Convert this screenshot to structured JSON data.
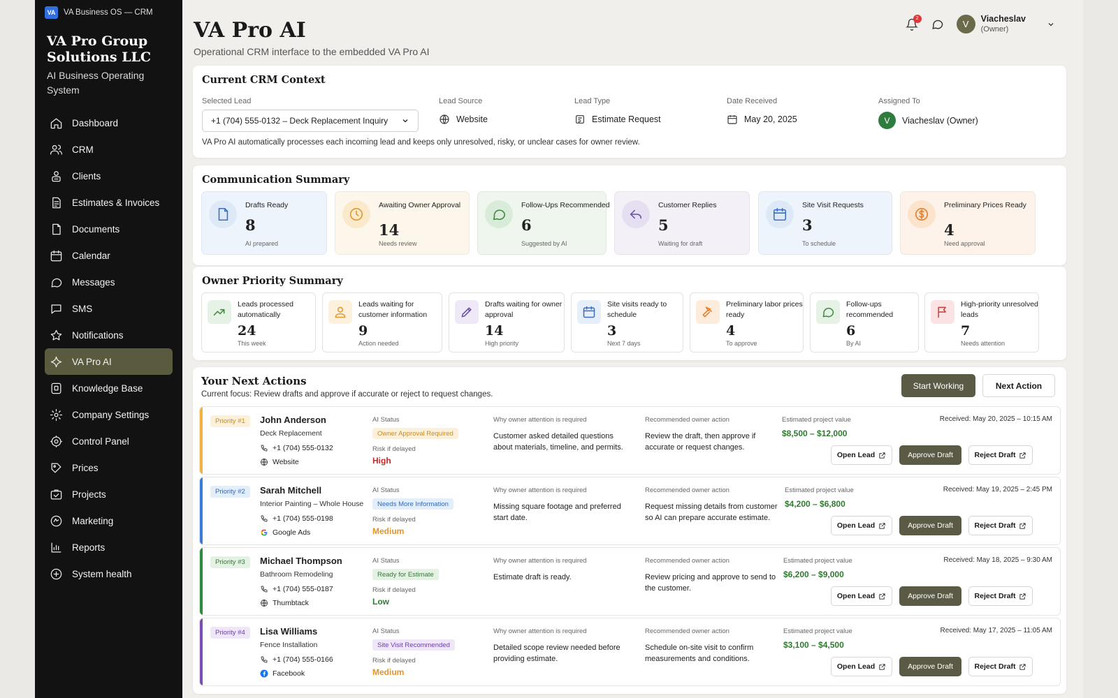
{
  "sidebar": {
    "app_title": "VA Business OS — CRM",
    "badge": "VA",
    "company": "VA Pro Group Solutions LLC",
    "tagline": "AI Business Operating System",
    "items": [
      {
        "label": "Dashboard",
        "icon": "home-icon"
      },
      {
        "label": "CRM",
        "icon": "users-icon"
      },
      {
        "label": "Clients",
        "icon": "clients-icon"
      },
      {
        "label": "Estimates & Invoices",
        "icon": "file-text-icon"
      },
      {
        "label": "Documents",
        "icon": "document-icon"
      },
      {
        "label": "Calendar",
        "icon": "calendar-icon"
      },
      {
        "label": "Messages",
        "icon": "message-icon"
      },
      {
        "label": "SMS",
        "icon": "sms-icon"
      },
      {
        "label": "Notifications",
        "icon": "bell-icon"
      },
      {
        "label": "VA Pro AI",
        "icon": "sparkle-icon",
        "active": true
      },
      {
        "label": "Knowledge Base",
        "icon": "book-icon"
      },
      {
        "label": "Company Settings",
        "icon": "gear-icon"
      },
      {
        "label": "Control Panel",
        "icon": "control-icon"
      },
      {
        "label": "Prices",
        "icon": "price-icon"
      },
      {
        "label": "Projects",
        "icon": "projects-icon"
      },
      {
        "label": "Marketing",
        "icon": "marketing-icon"
      },
      {
        "label": "Reports",
        "icon": "reports-icon"
      },
      {
        "label": "System health",
        "icon": "health-icon"
      }
    ]
  },
  "header": {
    "title": "VA Pro AI",
    "subtitle": "Operational CRM interface to the embedded VA Pro AI",
    "notif_count": "2",
    "user_initial": "V",
    "user_name": "Viacheslav",
    "user_role": "(Owner)"
  },
  "context": {
    "title": "Current CRM Context",
    "selected_lead_label": "Selected Lead",
    "selected_lead": "+1 (704) 555-0132 – Deck Replacement Inquiry",
    "lead_source_label": "Lead Source",
    "lead_source": "Website",
    "lead_type_label": "Lead Type",
    "lead_type": "Estimate Request",
    "date_label": "Date Received",
    "date": "May 20, 2025",
    "assigned_label": "Assigned To",
    "assigned_initial": "V",
    "assigned": "Viacheslav (Owner)",
    "note": "VA Pro AI automatically processes each incoming lead and keeps only unresolved, risky, or unclear cases for owner review."
  },
  "comm": {
    "title": "Communication Summary",
    "tiles": [
      {
        "label": "Drafts Ready",
        "value": "8",
        "sub": "AI prepared",
        "icon": "document-icon",
        "bg": "#eef4fb",
        "icbg": "#dde9f7",
        "color": "#3a6fc4"
      },
      {
        "label": "Awaiting Owner Approval",
        "value": "14",
        "sub": "Needs review",
        "icon": "clock-icon",
        "bg": "#fdf6ea",
        "icbg": "#fbe9cb",
        "color": "#e0962b"
      },
      {
        "label": "Follow-Ups Recommended",
        "value": "6",
        "sub": "Suggested by AI",
        "icon": "chat-icon",
        "bg": "#eef6ee",
        "icbg": "#d9ecd9",
        "color": "#3c8a3c"
      },
      {
        "label": "Customer Replies",
        "value": "5",
        "sub": "Waiting for draft",
        "icon": "reply-icon",
        "bg": "#f3f0f8",
        "icbg": "#e6dff1",
        "color": "#6a4fa8"
      },
      {
        "label": "Site Visit Requests",
        "value": "3",
        "sub": "To schedule",
        "icon": "calendar-icon",
        "bg": "#eef4fb",
        "icbg": "#dde9f7",
        "color": "#3a6fc4"
      },
      {
        "label": "Preliminary Prices Ready",
        "value": "4",
        "sub": "Need approval",
        "icon": "dollar-icon",
        "bg": "#fdf3ea",
        "icbg": "#fbe3cc",
        "color": "#e07e2b"
      }
    ]
  },
  "owner": {
    "title": "Owner Priority Summary",
    "tiles": [
      {
        "label": "Leads processed automatically",
        "value": "24",
        "sub": "This week",
        "icon": "trend-up-icon",
        "icbg": "#e6f2e6",
        "color": "#3c8a3c"
      },
      {
        "label": "Leads waiting for customer information",
        "value": "9",
        "sub": "Action needed",
        "icon": "user-icon",
        "icbg": "#fdf1dd",
        "color": "#e0962b"
      },
      {
        "label": "Drafts waiting for owner approval",
        "value": "14",
        "sub": "High priority",
        "icon": "pencil-icon",
        "icbg": "#efe9f7",
        "color": "#6a4fa8"
      },
      {
        "label": "Site visits ready to schedule",
        "value": "3",
        "sub": "Next 7 days",
        "icon": "calendar-icon",
        "icbg": "#e5eef9",
        "color": "#3a6fc4"
      },
      {
        "label": "Preliminary labor prices ready",
        "value": "4",
        "sub": "To approve",
        "icon": "hammer-icon",
        "icbg": "#fdebdc",
        "color": "#e07e2b"
      },
      {
        "label": "Follow-ups recommended",
        "value": "6",
        "sub": "By AI",
        "icon": "chat-icon",
        "icbg": "#e6f2e6",
        "color": "#3c8a3c"
      },
      {
        "label": "High-priority unresolved leads",
        "value": "7",
        "sub": "Needs attention",
        "icon": "flag-icon",
        "icbg": "#fbe3e3",
        "color": "#c93c3c"
      }
    ]
  },
  "actions": {
    "title": "Your Next Actions",
    "focus": "Current focus: Review drafts and approve if accurate or reject to request changes.",
    "start_label": "Start Working",
    "next_label": "Next Action",
    "ai_status_label": "AI Status",
    "risk_label": "Risk if delayed",
    "why_label": "Why owner attention is required",
    "rec_label": "Recommended owner action",
    "value_label": "Estimated project value",
    "open_label": "Open Lead",
    "approve_label": "Approve Draft",
    "reject_label": "Reject Draft",
    "rows": [
      {
        "priority": "Priority #1",
        "name": "John Anderson",
        "service": "Deck Replacement",
        "phone": "+1 (704) 555-0132",
        "source": "Website",
        "source_icon": "globe-icon",
        "status": "Owner Approval Required",
        "risk": "High",
        "why": "Customer asked detailed questions about materials, timeline, and permits.",
        "rec": "Review the draft, then approve if accurate or request changes.",
        "value": "$8,500 – $12,000",
        "received": "Received: May 20, 2025 – 10:15 AM",
        "accent": "#f0b43c",
        "pri_bg": "#fdf0d8",
        "pri_fg": "#c78a1e",
        "st_bg": "#fdf0d8",
        "st_fg": "#d38a1a",
        "risk_color": "#c62828"
      },
      {
        "priority": "Priority #2",
        "name": "Sarah Mitchell",
        "service": "Interior Painting – Whole House",
        "phone": "+1 (704) 555-0198",
        "source": "Google Ads",
        "source_icon": "google-icon",
        "status": "Needs More Information",
        "risk": "Medium",
        "why": "Missing square footage and preferred start date.",
        "rec": "Request missing details from customer so AI can prepare accurate estimate.",
        "value": "$4,200 – $6,800",
        "received": "Received: May 19, 2025 – 2:45 PM",
        "accent": "#3a7bd5",
        "pri_bg": "#e3eefb",
        "pri_fg": "#3468b8",
        "st_bg": "#e3eefb",
        "st_fg": "#3468b8",
        "risk_color": "#e0962b"
      },
      {
        "priority": "Priority #3",
        "name": "Michael Thompson",
        "service": "Bathroom Remodeling",
        "phone": "+1 (704) 555-0187",
        "source": "Thumbtack",
        "source_icon": "globe-icon",
        "status": "Ready for Estimate",
        "risk": "Low",
        "why": "Estimate draft is ready.",
        "rec": "Review pricing and approve to send to the customer.",
        "value": "$6,200 – $9,000",
        "received": "Received: May 18, 2025 – 9:30 AM",
        "accent": "#2e8b3e",
        "pri_bg": "#e3f2e3",
        "pri_fg": "#2e7d32",
        "st_bg": "#e3f2e3",
        "st_fg": "#2e7d32",
        "risk_color": "#2e7d32"
      },
      {
        "priority": "Priority #4",
        "name": "Lisa Williams",
        "service": "Fence Installation",
        "phone": "+1 (704) 555-0166",
        "source": "Facebook",
        "source_icon": "facebook-icon",
        "status": "Site Visit Recommended",
        "risk": "Medium",
        "why": "Detailed scope review needed before providing estimate.",
        "rec": "Schedule on-site visit to confirm measurements and conditions.",
        "value": "$3,100 – $4,500",
        "received": "Received: May 17, 2025 – 11:05 AM",
        "accent": "#7a4fb5",
        "pri_bg": "#efe6f8",
        "pri_fg": "#6a3fa8",
        "st_bg": "#efe6f8",
        "st_fg": "#6a3fa8",
        "risk_color": "#e0962b"
      }
    ]
  }
}
